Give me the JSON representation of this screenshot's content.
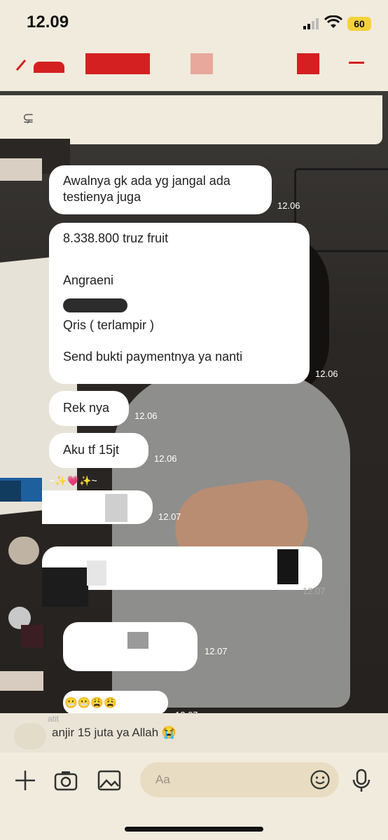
{
  "status_bar": {
    "time": "12.09",
    "battery": "60"
  },
  "messages": [
    {
      "text": "Awalnya gk ada yg jangal ada testienya juga",
      "time": "12.06"
    },
    {
      "lines": [
        "8.338.800 truz fruit",
        "",
        "Angraeni",
        "",
        "Qris ( terlampir )",
        "",
        "Send bukti paymentnya ya nanti"
      ],
      "time": "12.06"
    },
    {
      "text": "Rek nya",
      "time": "12.06"
    },
    {
      "text": "Aku tf 15jt",
      "time": "12.06"
    }
  ],
  "incoming": {
    "emoji_line": "~✨💗✨~",
    "times": [
      "12.07",
      "12.07",
      "12.07",
      "12.07"
    ],
    "emoji_row": "😬😬😩😩"
  },
  "reply_preview": {
    "sender": "atit",
    "text": "anjir 15 juta ya Allah 😭"
  },
  "input": {
    "placeholder": "Aa"
  },
  "icons": [
    "plus-icon",
    "camera-icon",
    "image-icon",
    "emoji-icon",
    "microphone-icon"
  ],
  "colors": {
    "header_bg": "#f1ebdd",
    "bubble": "#ffffff",
    "input_field": "#e8ddc2",
    "redaction": "#d42020"
  }
}
